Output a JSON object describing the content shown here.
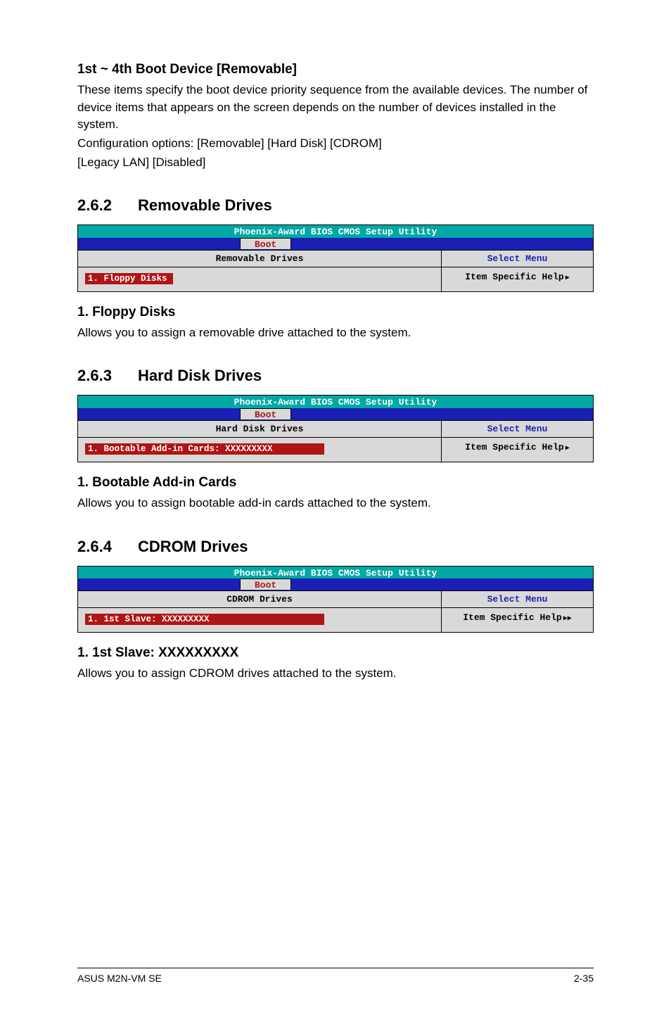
{
  "sec1": {
    "heading": "1st ~ 4th Boot Device [Removable]",
    "p1": "These items specify the boot device priority sequence from the available devices. The number of device items that appears on the screen depends on the number of devices installed in the system.",
    "p2": "Configuration options: [Removable] [Hard Disk] [CDROM]",
    "p3": "[Legacy LAN] [Disabled]"
  },
  "s262": {
    "num": "2.6.2",
    "title": "Removable Drives",
    "bios": {
      "top": "Phoenix-Award BIOS CMOS Setup Utility",
      "tab": "Boot",
      "left_label": "Removable Drives",
      "right_label": "Select Menu",
      "item": "1. Floppy Disks",
      "help": "Item Specific Help"
    },
    "sub_heading": "1. Floppy Disks",
    "sub_text": "Allows you to assign a removable drive attached to the system."
  },
  "s263": {
    "num": "2.6.3",
    "title": "Hard Disk Drives",
    "bios": {
      "top": "Phoenix-Award BIOS CMOS Setup Utility",
      "tab": "Boot",
      "left_label": "Hard Disk Drives",
      "right_label": "Select Menu",
      "item": "1. Bootable Add-in Cards: XXXXXXXXX",
      "help": "Item Specific Help"
    },
    "sub_heading": "1. Bootable Add-in Cards",
    "sub_text": "Allows you to assign bootable add-in cards attached to the system."
  },
  "s264": {
    "num": "2.6.4",
    "title": "CDROM Drives",
    "bios": {
      "top": "Phoenix-Award BIOS CMOS Setup Utility",
      "tab": "Boot",
      "left_label": "CDROM Drives",
      "right_label": "Select Menu",
      "item": "1. 1st Slave: XXXXXXXXX",
      "help": "Item Specific Help"
    },
    "sub_heading": "1. 1st Slave: XXXXXXXXX",
    "sub_text": "Allows you to assign CDROM drives attached to the system."
  },
  "footer": {
    "left": "ASUS M2N-VM SE",
    "right": "2-35"
  }
}
